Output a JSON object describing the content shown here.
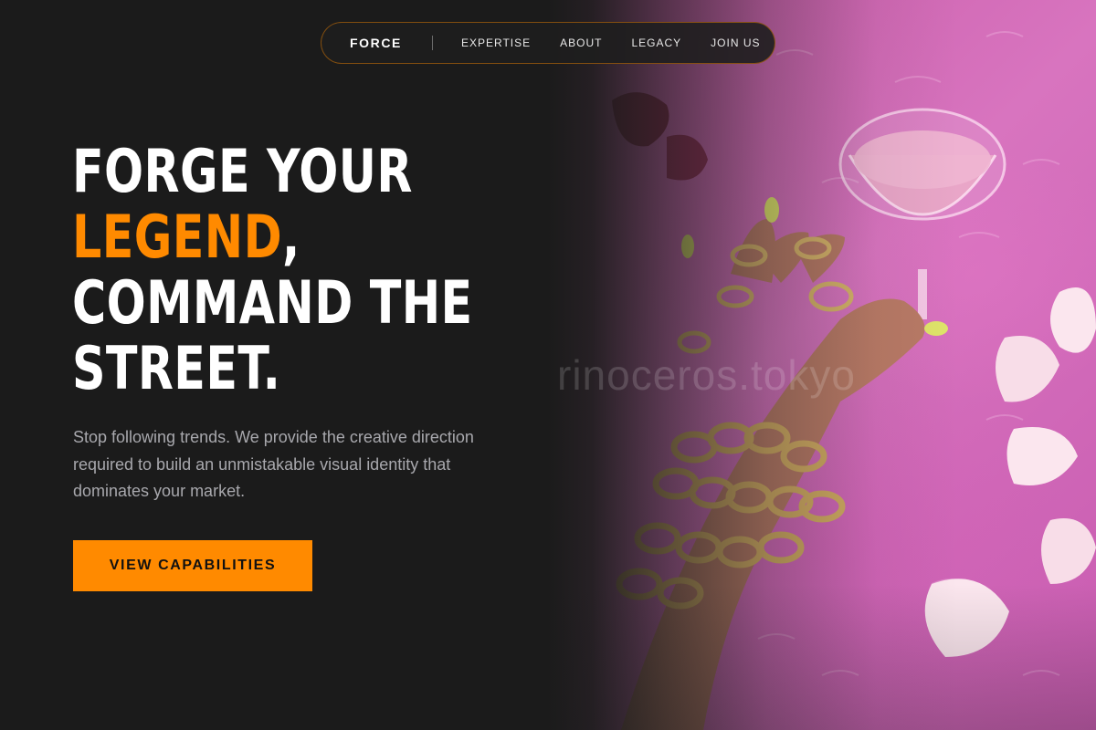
{
  "nav": {
    "brand": "FORCE",
    "links": [
      "EXPERTISE",
      "ABOUT",
      "LEGACY",
      "JOIN US"
    ]
  },
  "hero": {
    "headline_line1": "FORGE YOUR",
    "headline_accent": "LEGEND",
    "headline_comma": ",",
    "headline_line3": "COMMAND THE",
    "headline_line4": "STREET.",
    "lede": "Stop following trends. We provide the creative direction required to build an unmistakable visual identity that dominates your market.",
    "cta_label": "VIEW CAPABILITIES"
  },
  "image": {
    "watermark": "rinoceros.tokyo",
    "subject": "hand with gold rings and chain bracelets holding a pink cocktail glass on pink fur with petals"
  },
  "colors": {
    "background": "#1b1b1b",
    "accent": "#ff8a00",
    "headline": "#ffffff",
    "body_text": "#a8a8ad",
    "photo_pink": "#d874bf"
  }
}
